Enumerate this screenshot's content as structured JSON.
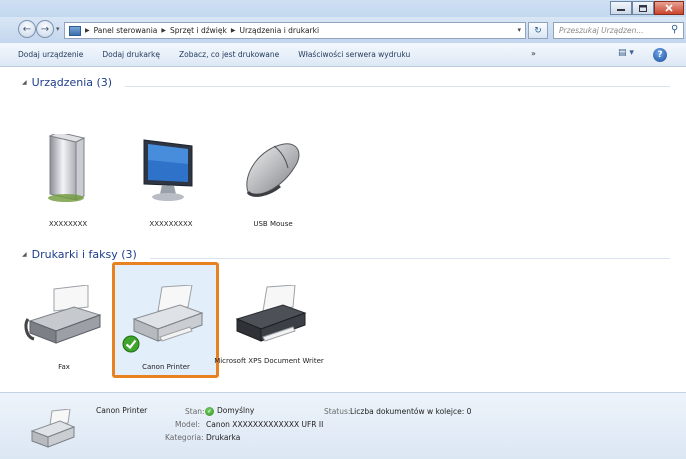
{
  "address_bar": {
    "crumbs": [
      "Panel sterowania",
      "Sprzęt i dźwięk",
      "Urządzenia i drukarki"
    ]
  },
  "search": {
    "placeholder": "Przeszukaj Urządzen..."
  },
  "command_bar": {
    "items": [
      "Dodaj urządzenie",
      "Dodaj drukarkę",
      "Zobacz, co jest drukowane",
      "Właściwości serwera wydruku"
    ],
    "more": "»"
  },
  "groups": {
    "devices": {
      "title": "Urządzenia (3)",
      "items": [
        "XXXXXXXX",
        "XXXXXXXXX",
        "USB Mouse"
      ]
    },
    "printers": {
      "title": "Drukarki i faksy (3)",
      "items": [
        "Fax",
        "Canon Printer",
        "Microsoft XPS Document Writer"
      ]
    }
  },
  "details": {
    "name": "Canon Printer",
    "state_label": "Stan:",
    "state_value": "Domyślny",
    "status_label": "Status:",
    "status_value": "Liczba dokumentów w kolejce: 0",
    "model_label": "Model:",
    "model_value": "Canon XXXXXXXXXXXXX UFR II",
    "category_label": "Kategoria:",
    "category_value": "Drukarka"
  },
  "colors": {
    "selection_outline": "#e8811f",
    "group_title": "#1e3d8c"
  }
}
